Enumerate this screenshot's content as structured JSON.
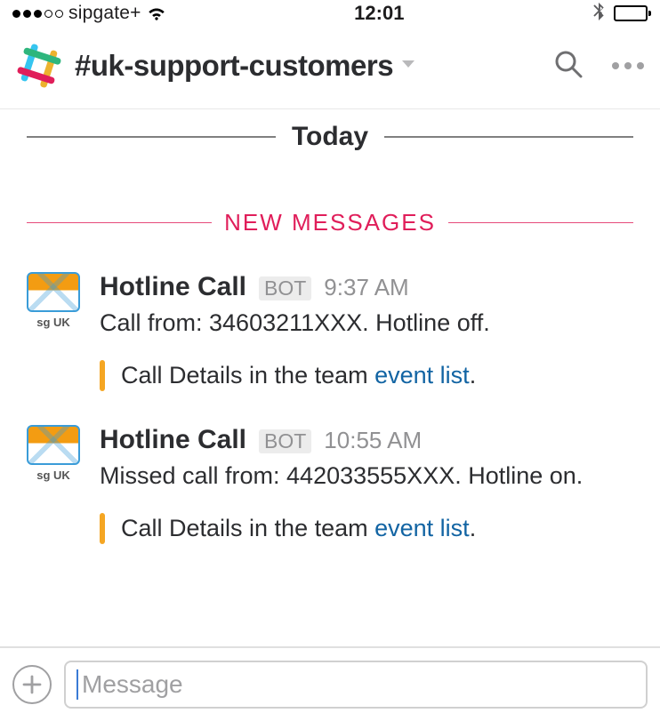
{
  "status": {
    "carrier": "sipgate+",
    "time": "12:01"
  },
  "header": {
    "channel": "#uk-support-customers"
  },
  "date_divider": "Today",
  "new_messages_label": "NEW MESSAGES",
  "avatar_caption": "sg UK",
  "bot_badge": "BOT",
  "messages": [
    {
      "author": "Hotline Call",
      "time": "9:37 AM",
      "text": "Call from: 34603211XXX. Hotline off.",
      "attachment_prefix": "Call Details in the team ",
      "attachment_link": "event list",
      "attachment_suffix": "."
    },
    {
      "author": "Hotline Call",
      "time": "10:55 AM",
      "text": "Missed call from: 442033555XXX. Hotline on.",
      "attachment_prefix": "Call Details in the team ",
      "attachment_link": "event list",
      "attachment_suffix": "."
    }
  ],
  "composer": {
    "placeholder": "Message"
  }
}
